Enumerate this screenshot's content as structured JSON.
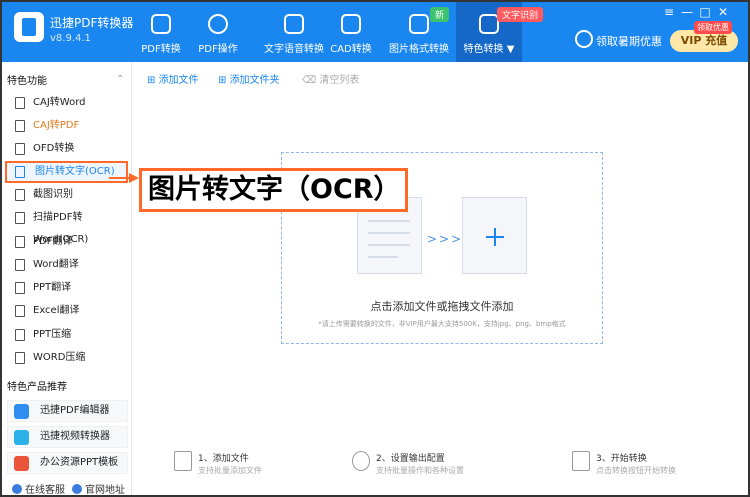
{
  "app": {
    "name": "迅捷PDF转换器",
    "version": "v8.9.4.1"
  },
  "nav": [
    {
      "label": "PDF转换",
      "icon": "convert-icon"
    },
    {
      "label": "PDF操作",
      "icon": "gear-icon"
    },
    {
      "label": "文字语音转换",
      "icon": "audio-icon"
    },
    {
      "label": "CAD转换",
      "icon": "download-box-icon"
    },
    {
      "label": "图片格式转换",
      "icon": "image-icon",
      "badge": "新"
    },
    {
      "label": "特色转换",
      "icon": "star-box-icon",
      "badge": "文字识别",
      "suffix": "▼"
    }
  ],
  "header": {
    "vip_link": "领取暑期优惠",
    "vip_button": "VIP 充值",
    "vip_tag": "领取优惠"
  },
  "window_controls": [
    "≡",
    "—",
    "□",
    "✕"
  ],
  "sidebar": {
    "section1": "特色功能",
    "items": [
      "CAJ转Word",
      "CAJ转PDF",
      "OFD转换",
      "图片转文字(OCR)",
      "截图识别",
      "扫描PDF转Word(OCR)",
      "PDF翻译",
      "Word翻译",
      "PPT翻译",
      "Excel翻译",
      "PPT压缩",
      "WORD压缩"
    ],
    "section2": "特色产品推荐",
    "products": [
      "迅捷PDF编辑器",
      "迅捷视频转换器",
      "办公资源PPT模板"
    ],
    "footer": [
      "在线客服",
      "官网地址"
    ]
  },
  "toolbar": {
    "add_file": "添加文件",
    "add_folder": "添加文件夹",
    "clear": "清空列表"
  },
  "dropzone": {
    "title": "点击添加文件或拖拽文件添加",
    "hint": "*请上传需要转换的文件，非VIP用户最大支持500K，支持jpg、png、bmp格式"
  },
  "steps": [
    {
      "title": "1、添加文件",
      "sub": "支持批量添加文件"
    },
    {
      "title": "2、设置输出配置",
      "sub": "支持批量操作和各种设置"
    },
    {
      "title": "3、开始转换",
      "sub": "点击转换按钮开始转换"
    }
  ],
  "callout": "图片转文字（OCR）"
}
